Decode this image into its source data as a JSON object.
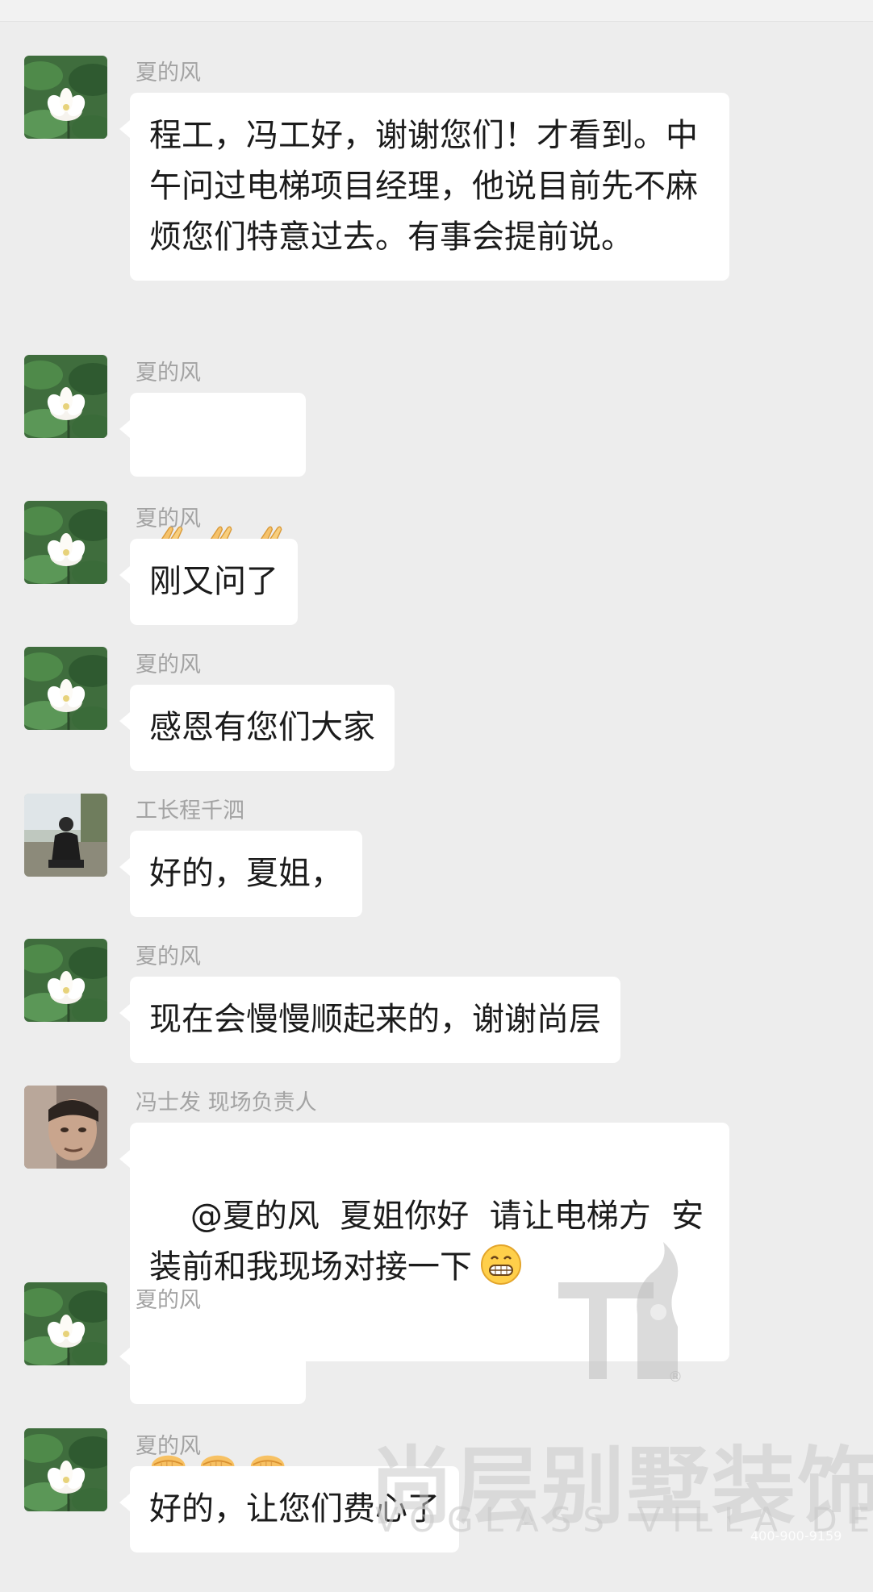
{
  "messages": [
    {
      "sender": "夏的风",
      "avatar": "lotus-avatar",
      "text": "程工，冯工好，谢谢您们！才看到。中午问过电梯项目经理，他说目前先不麻烦您们特意过去。有事会提前说。"
    },
    {
      "sender": "夏的风",
      "avatar": "lotus-avatar",
      "emoji": [
        "pray-emoji",
        "pray-emoji",
        "pray-emoji"
      ]
    },
    {
      "sender": "夏的风",
      "avatar": "lotus-avatar",
      "text": "刚又问了"
    },
    {
      "sender": "夏的风",
      "avatar": "lotus-avatar",
      "text": "感恩有您们大家"
    },
    {
      "sender": "工长程千泗",
      "avatar": "man-outdoor-avatar",
      "text": "好的，夏姐，"
    },
    {
      "sender": "夏的风",
      "avatar": "lotus-avatar",
      "text": "现在会慢慢顺起来的，谢谢尚层"
    },
    {
      "sender": "冯士发  现场负责人",
      "avatar": "man-portrait-avatar",
      "text": "@夏的风  夏姐你好  请让电梯方  安装前和我现场对接一下",
      "trailing_emoji": "grin-emoji"
    },
    {
      "sender": "夏的风",
      "avatar": "lotus-avatar",
      "emoji": [
        "handshake-emoji",
        "handshake-emoji",
        "handshake-emoji"
      ]
    },
    {
      "sender": "夏的风",
      "avatar": "lotus-avatar",
      "text": "好的，让您们费心了"
    }
  ],
  "watermark": {
    "brand_cn": "尚层别墅装饰",
    "brand_en": "VOGLASS VILLA DEC",
    "phone": "400-900-9159",
    "registered": "®"
  },
  "colors": {
    "background": "#ededed",
    "bubble": "#ffffff",
    "sender_name": "#a3a3a3",
    "text": "#1b1b1b"
  }
}
